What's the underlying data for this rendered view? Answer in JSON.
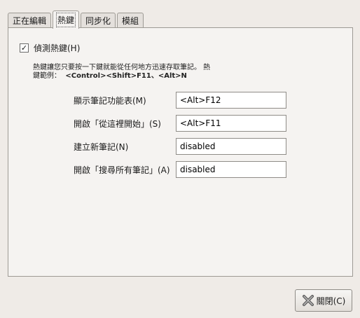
{
  "tabs": [
    {
      "label": "正在編輯"
    },
    {
      "label": "熱鍵"
    },
    {
      "label": "同步化"
    },
    {
      "label": "模組"
    }
  ],
  "hotkeys": {
    "enable_checked": true,
    "enable_check_glyph": "✓",
    "enable_label": "偵測熱鍵(H)",
    "description_line1": "熱鍵讓您只要按一下鍵就能從任何地方迅速存取筆記。 熱",
    "description_prefix": "鍵範例：",
    "description_examples": "<Control><Shift>F11、<Alt>N",
    "rows": [
      {
        "label": "顯示筆記功能表(M)",
        "value": "<Alt>F12"
      },
      {
        "label": "開啟「從這裡開始」(S)",
        "value": "<Alt>F11"
      },
      {
        "label": "建立新筆記(N)",
        "value": "disabled"
      },
      {
        "label": "開啟「搜尋所有筆記」(A)",
        "value": "disabled"
      }
    ]
  },
  "footer": {
    "close_label": "關閉(C)",
    "close_icon": "close-icon"
  }
}
